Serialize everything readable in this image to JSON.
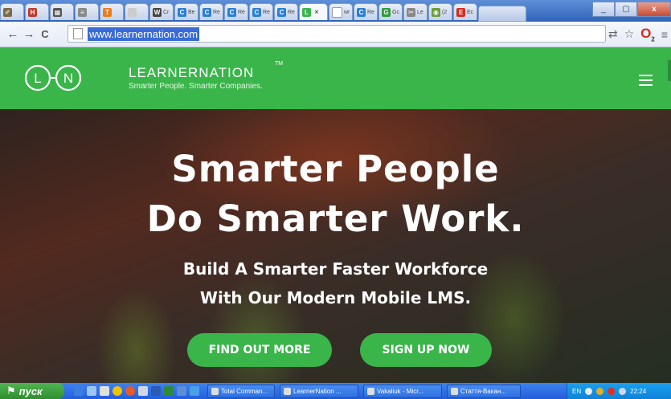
{
  "browser": {
    "tabs": [
      {
        "label": "",
        "fav": "tool-icon",
        "color": "#7a6a4a",
        "glyph": "✐"
      },
      {
        "label": "",
        "fav": "hn-icon",
        "color": "#c0392b",
        "glyph": "H"
      },
      {
        "label": "",
        "fav": "grid-icon",
        "color": "#555555",
        "glyph": "▦"
      },
      {
        "label": "",
        "fav": "news-icon",
        "color": "#8a8a8a",
        "glyph": "≡"
      },
      {
        "label": "",
        "fav": "t-icon",
        "color": "#e67e22",
        "glyph": "T"
      },
      {
        "label": "",
        "fav": "blank-icon",
        "color": "#cccccc",
        "glyph": ""
      },
      {
        "label": "Cr",
        "fav": "w-icon",
        "color": "#444444",
        "glyph": "W"
      },
      {
        "label": "Be",
        "fav": "c-icon",
        "color": "#2a7fd4",
        "glyph": "C"
      },
      {
        "label": "Re",
        "fav": "c-icon",
        "color": "#2a7fd4",
        "glyph": "C"
      },
      {
        "label": "Re",
        "fav": "c-icon",
        "color": "#2a7fd4",
        "glyph": "C"
      },
      {
        "label": "Re",
        "fav": "c-icon",
        "color": "#2a7fd4",
        "glyph": "C"
      },
      {
        "label": "Re",
        "fav": "c-icon",
        "color": "#2a7fd4",
        "glyph": "C"
      },
      {
        "label": "",
        "fav": "ln-icon",
        "color": "#3ab54a",
        "glyph": "L",
        "active": true
      },
      {
        "label": "wr",
        "fav": "page-icon",
        "color": "#ffffff",
        "glyph": ""
      },
      {
        "label": "Re",
        "fav": "c-icon",
        "color": "#2a7fd4",
        "glyph": "C"
      },
      {
        "label": "Gc",
        "fav": "g-icon",
        "color": "#2e9b3a",
        "glyph": "G"
      },
      {
        "label": "Le",
        "fav": "tool-icon",
        "color": "#888888",
        "glyph": "✂"
      },
      {
        "label": "(2",
        "fav": "circle-icon",
        "color": "#6a9b3a",
        "glyph": "◉"
      },
      {
        "label": "Ec",
        "fav": "e-icon",
        "color": "#d52b1e",
        "glyph": "E"
      }
    ],
    "close_glyph": "×",
    "window": {
      "min": "_",
      "max": "▢",
      "close": "x"
    },
    "nav": {
      "back": "←",
      "forward": "→",
      "reload": "C"
    },
    "url": "www.learnernation.com",
    "toolbar_icons": {
      "translate": "⇄",
      "star": "☆",
      "opera": "O",
      "menu": "≡",
      "opera_badge": "2"
    }
  },
  "site": {
    "brand": "LEARNERNATION",
    "tm": "TM",
    "tagline": "Smarter People. Smarter Companies.",
    "logo_letters": [
      "L",
      "N"
    ],
    "hero": {
      "line1": "Smarter People",
      "line2": "Do Smarter Work.",
      "sub1": "Build A Smarter Faster Workforce",
      "sub2": "With Our Modern Mobile LMS.",
      "cta1": "FIND OUT MORE",
      "cta2": "SIGN UP NOW"
    },
    "accent": "#3ab54a"
  },
  "taskbar": {
    "start": "пуск",
    "tasks": [
      {
        "label": "Total Comman...",
        "width": 84
      },
      {
        "label": "LearnerNation ...",
        "width": 98
      },
      {
        "label": "Vakaliuk - Micr...",
        "width": 98
      },
      {
        "label": "Стаття-Вакан...",
        "width": 92
      }
    ],
    "tray": {
      "lang": "EN",
      "time": "22:24"
    }
  }
}
